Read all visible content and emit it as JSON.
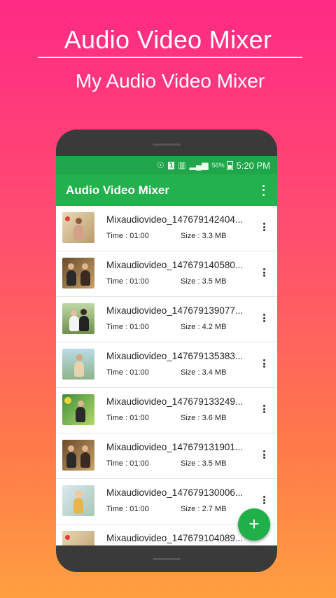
{
  "promo": {
    "title": "Audio Video Mixer",
    "subtitle": "My Audio Video Mixer"
  },
  "status_bar": {
    "battery_percent": "56%",
    "time": "5:20 PM",
    "sim_badge": "1"
  },
  "app_bar": {
    "title": "Audio Video Mixer",
    "menu_icon": "overflow-menu-icon"
  },
  "list": {
    "items": [
      {
        "name": "Mixaudiovideo_147679142404...",
        "time": "Time : 01:00",
        "size": "Size : 3.3 MB"
      },
      {
        "name": "Mixaudiovideo_147679140580...",
        "time": "Time : 01:00",
        "size": "Size : 3.5 MB"
      },
      {
        "name": "Mixaudiovideo_147679139077...",
        "time": "Time : 01:00",
        "size": "Size : 4.2 MB"
      },
      {
        "name": "Mixaudiovideo_147679135383...",
        "time": "Time : 01:00",
        "size": "Size : 3.4 MB"
      },
      {
        "name": "Mixaudiovideo_147679133249...",
        "time": "Time : 01:00",
        "size": "Size : 3.6 MB"
      },
      {
        "name": "Mixaudiovideo_147679131901...",
        "time": "Time : 01:00",
        "size": "Size : 3.5 MB"
      },
      {
        "name": "Mixaudiovideo_147679130006...",
        "time": "Time : 01:00",
        "size": "Size : 2.7 MB"
      },
      {
        "name": "Mixaudiovideo_147679104089...",
        "time": "",
        "size": ""
      }
    ]
  },
  "fab": {
    "label": "+"
  },
  "colors": {
    "accent": "#22b14c",
    "status_bar": "#1fa54a",
    "background_top": "#ff2a85",
    "background_bottom": "#ff9f40"
  }
}
